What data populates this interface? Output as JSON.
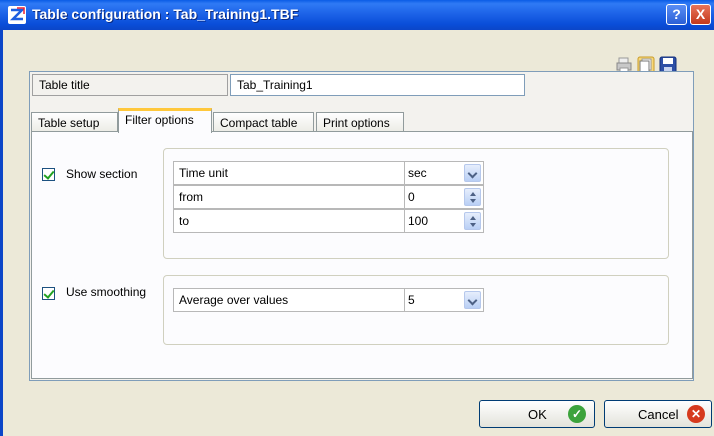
{
  "window": {
    "title": "Table configuration : Tab_Training1.TBF",
    "help_label": "?",
    "close_label": "X"
  },
  "table_title": {
    "label": "Table title",
    "value": "Tab_Training1"
  },
  "tabs": [
    {
      "label": "Table setup"
    },
    {
      "label": "Filter options"
    },
    {
      "label": "Compact table"
    },
    {
      "label": "Print options"
    }
  ],
  "show_section": {
    "label": "Show section",
    "checked": true,
    "rows": [
      {
        "label": "Time unit",
        "value": "sec"
      },
      {
        "label": "from",
        "value": "0"
      },
      {
        "label": "to",
        "value": "100"
      }
    ]
  },
  "smoothing": {
    "label": "Use smoothing",
    "checked": true,
    "row": {
      "label": "Average over values",
      "value": "5"
    }
  },
  "buttons": {
    "ok": "OK",
    "cancel": "Cancel"
  },
  "icons": [
    "app-logo-icon",
    "print-icon",
    "copy-icon",
    "save-icon",
    "help-icon",
    "close-icon",
    "dropdown-icon",
    "spin-icon",
    "ok-check-icon",
    "cancel-x-icon"
  ],
  "colors": {
    "titlebar": "#0a4ed9",
    "tab_highlight": "#ffc83c",
    "ok_green": "#3ca33c",
    "cancel_red": "#d63a1e"
  }
}
